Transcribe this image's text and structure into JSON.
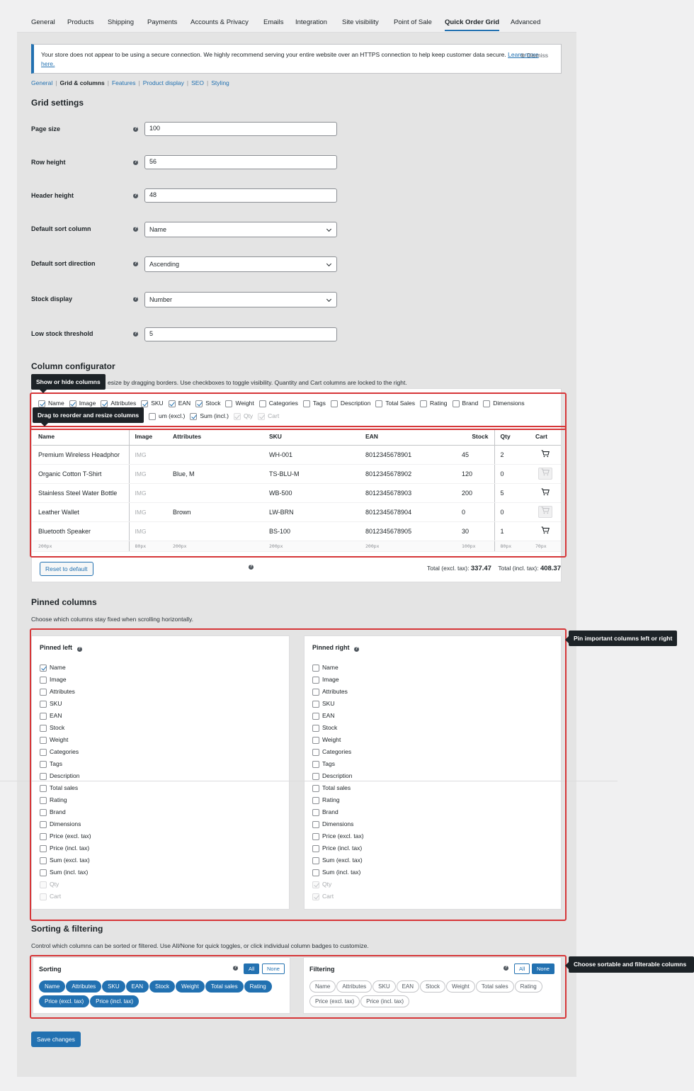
{
  "tabs": [
    "General",
    "Products",
    "Shipping",
    "Payments",
    "Accounts & Privacy",
    "Emails",
    "Integration",
    "Site visibility",
    "Point of Sale",
    "Quick Order Grid",
    "Advanced"
  ],
  "active_tab": "Quick Order Grid",
  "notice": {
    "text": "Your store does not appear to be using a secure connection. We highly recommend serving your entire website over an HTTPS connection to help keep customer data secure.",
    "link": "Learn more here.",
    "dismiss": "Dismiss"
  },
  "subnav": {
    "items": [
      "General",
      "Grid & columns",
      "Features",
      "Product display",
      "SEO",
      "Styling"
    ],
    "current": "Grid & columns"
  },
  "grid_settings": {
    "heading": "Grid settings",
    "page_size": {
      "label": "Page size",
      "value": "100"
    },
    "row_height": {
      "label": "Row height",
      "value": "56"
    },
    "header_height": {
      "label": "Header height",
      "value": "48"
    },
    "default_sort_column": {
      "label": "Default sort column",
      "value": "Name"
    },
    "default_sort_direction": {
      "label": "Default sort direction",
      "value": "Ascending"
    },
    "stock_display": {
      "label": "Stock display",
      "value": "Number"
    },
    "low_stock_threshold": {
      "label": "Low stock threshold",
      "value": "5"
    }
  },
  "column_configurator": {
    "heading": "Column configurator",
    "description": "esize by dragging borders. Use checkboxes to toggle visibility. Quantity and Cart columns are locked to the right.",
    "tooltip_show_hide": "Show or hide columns",
    "tooltip_drag": "Drag to reorder and resize columns",
    "visibility_row1": [
      {
        "label": "Name",
        "checked": true,
        "disabled": false
      },
      {
        "label": "Image",
        "checked": true,
        "disabled": false
      },
      {
        "label": "Attributes",
        "checked": true,
        "disabled": false
      },
      {
        "label": "SKU",
        "checked": true,
        "disabled": false
      },
      {
        "label": "EAN",
        "checked": true,
        "disabled": false
      },
      {
        "label": "Stock",
        "checked": true,
        "disabled": false
      },
      {
        "label": "Weight",
        "checked": false,
        "disabled": false
      },
      {
        "label": "Categories",
        "checked": false,
        "disabled": false
      },
      {
        "label": "Tags",
        "checked": false,
        "disabled": false
      },
      {
        "label": "Description",
        "checked": false,
        "disabled": false
      },
      {
        "label": "Total Sales",
        "checked": false,
        "disabled": false
      },
      {
        "label": "Rating",
        "checked": false,
        "disabled": false
      },
      {
        "label": "Brand",
        "checked": false,
        "disabled": false
      },
      {
        "label": "Dimensions",
        "checked": false,
        "disabled": false
      }
    ],
    "visibility_row2": [
      {
        "label": "um (excl.)",
        "checked": false,
        "disabled": false
      },
      {
        "label": "Sum (incl.)",
        "checked": true,
        "disabled": false
      },
      {
        "label": "Qty",
        "checked": true,
        "disabled": true
      },
      {
        "label": "Cart",
        "checked": true,
        "disabled": true
      }
    ],
    "columns": [
      "Name",
      "Image",
      "Attributes",
      "SKU",
      "EAN",
      "Stock",
      "Qty",
      "Cart"
    ],
    "rows": [
      {
        "name": "Premium Wireless Headphor",
        "image": "IMG",
        "attributes": "",
        "sku": "WH-001",
        "ean": "8012345678901",
        "stock": "45",
        "qty": "2",
        "cart_active": true
      },
      {
        "name": "Organic Cotton T-Shirt",
        "image": "IMG",
        "attributes": "Blue, M",
        "sku": "TS-BLU-M",
        "ean": "8012345678902",
        "stock": "120",
        "qty": "0",
        "cart_active": false
      },
      {
        "name": "Stainless Steel Water Bottle",
        "image": "IMG",
        "attributes": "",
        "sku": "WB-500",
        "ean": "8012345678903",
        "stock": "200",
        "qty": "5",
        "cart_active": true
      },
      {
        "name": "Leather Wallet",
        "image": "IMG",
        "attributes": "Brown",
        "sku": "LW-BRN",
        "ean": "8012345678904",
        "stock": "0",
        "qty": "0",
        "cart_active": false
      },
      {
        "name": "Bluetooth Speaker",
        "image": "IMG",
        "attributes": "",
        "sku": "BS-100",
        "ean": "8012345678905",
        "stock": "30",
        "qty": "1",
        "cart_active": true
      }
    ],
    "widths": [
      "200px",
      "80px",
      "200px",
      "200px",
      "200px",
      "100px",
      "80px",
      "70px"
    ],
    "reset_label": "Reset to default",
    "total_excl_label": "Total (excl. tax):",
    "total_excl": "337.47",
    "total_incl_label": "Total (incl. tax):",
    "total_incl": "408.37"
  },
  "pinned": {
    "heading": "Pinned columns",
    "description": "Choose which columns stay fixed when scrolling horizontally.",
    "tooltip": "Pin important columns left or right",
    "left_title": "Pinned left",
    "right_title": "Pinned right",
    "options": [
      "Name",
      "Image",
      "Attributes",
      "SKU",
      "EAN",
      "Stock",
      "Weight",
      "Categories",
      "Tags",
      "Description",
      "Total sales",
      "Rating",
      "Brand",
      "Dimensions",
      "Price (excl. tax)",
      "Price (incl. tax)",
      "Sum (excl. tax)",
      "Sum (incl. tax)",
      "Qty",
      "Cart"
    ],
    "left_checked": [
      "Name"
    ],
    "right_checked": [],
    "locked": [
      "Qty",
      "Cart"
    ]
  },
  "sorting_filtering": {
    "heading": "Sorting & filtering",
    "description": "Control which columns can be sorted or filtered. Use All/None for quick toggles, or click individual column badges to customize.",
    "tooltip": "Choose sortable and filterable columns",
    "all_label": "All",
    "none_label": "None",
    "sorting_title": "Sorting",
    "sorting_chips": [
      "Name",
      "Attributes",
      "SKU",
      "EAN",
      "Stock",
      "Weight",
      "Total sales",
      "Rating",
      "Price (excl. tax)",
      "Price (incl. tax)"
    ],
    "filtering_title": "Filtering",
    "filtering_chips": [
      "Name",
      "Attributes",
      "SKU",
      "EAN",
      "Stock",
      "Weight",
      "Total sales",
      "Rating",
      "Price (excl. tax)",
      "Price (incl. tax)"
    ]
  },
  "save_label": "Save changes"
}
